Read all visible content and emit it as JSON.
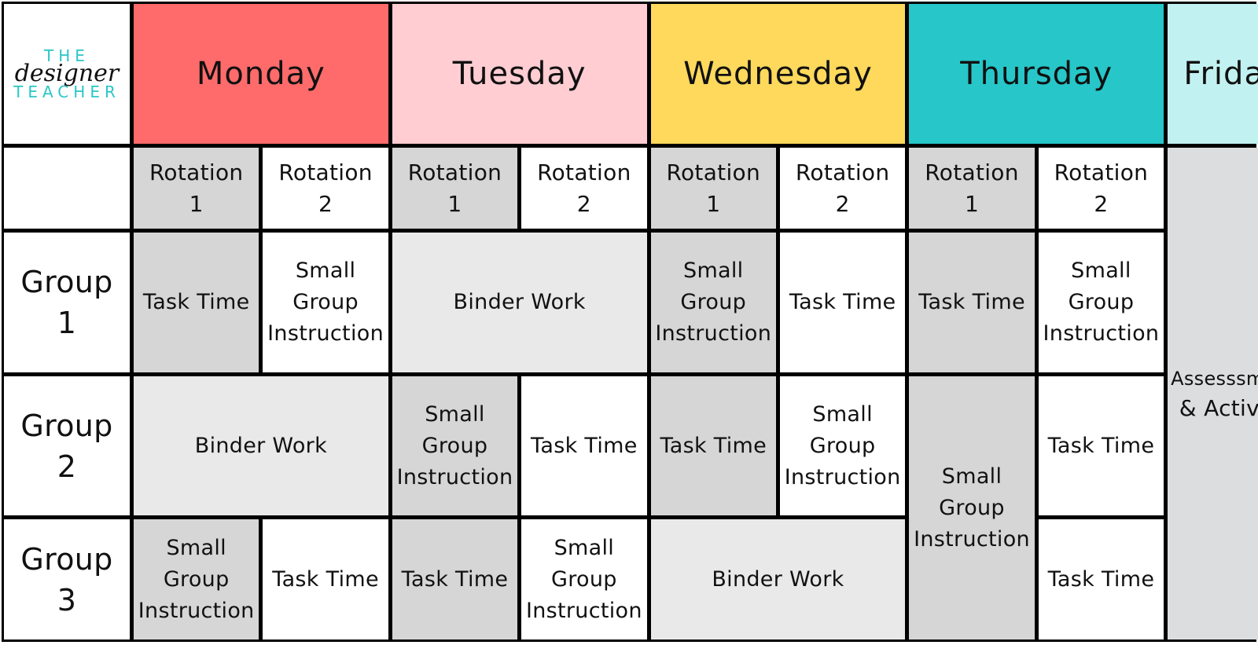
{
  "logo": {
    "line1": "THE",
    "line2": "designer",
    "line3": "TEACHER",
    "accent_color": "#2bc6c6"
  },
  "days": [
    {
      "label": "Monday",
      "color": "#ff6b6b"
    },
    {
      "label": "Tuesday",
      "color": "#ffcdd2"
    },
    {
      "label": "Wednesday",
      "color": "#ffd95c"
    },
    {
      "label": "Thursday",
      "color": "#26c6c9"
    },
    {
      "label": "Friday",
      "color": "#c2f1f1"
    }
  ],
  "rotations": [
    "Rotation\n1",
    "Rotation\n2"
  ],
  "groups": [
    "Group\n1",
    "Group\n2",
    "Group\n3"
  ],
  "activities": {
    "task_time": "Task Time",
    "small_group": "Small\nGroup\nInstruction",
    "binder_work": "Binder Work"
  },
  "friday_activity": {
    "line1": "Assesssment",
    "line2": "& Activity"
  },
  "schedule": {
    "monday": {
      "group1": [
        "Task Time",
        "Small Group Instruction"
      ],
      "group2": [
        "Binder Work"
      ],
      "group3": [
        "Small Group Instruction",
        "Task Time"
      ]
    },
    "tuesday": {
      "group1": [
        "Binder Work"
      ],
      "group2": [
        "Small Group Instruction",
        "Task Time"
      ],
      "group3": [
        "Task Time",
        "Small Group Instruction"
      ]
    },
    "wednesday": {
      "group1": [
        "Small Group Instruction",
        "Task Time"
      ],
      "group2": [
        "Task Time",
        "Small Group Instruction"
      ],
      "group3": [
        "Binder Work"
      ]
    },
    "thursday": {
      "group1": [
        "Task Time",
        "Small Group Instruction"
      ],
      "group2": [
        "Small Group Instruction (spans groups 2-3)",
        "Task Time"
      ],
      "group3": [
        "Small Group Instruction (spans groups 2-3)",
        "Task Time"
      ]
    },
    "friday": {
      "all_groups": [
        "Assesssment & Activity"
      ]
    }
  }
}
